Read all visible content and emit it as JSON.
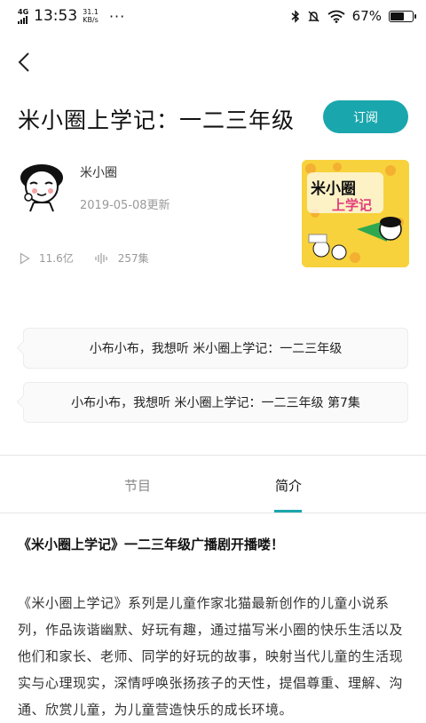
{
  "status_bar": {
    "network": "4G",
    "time": "13:53",
    "speed_value": "31.1",
    "speed_unit": "KB/s",
    "more": "···",
    "battery": "67%",
    "battery_level": 0.67
  },
  "header": {
    "back_icon": "chevron-left-icon"
  },
  "album": {
    "title": "米小圈上学记：一二三年级",
    "subscribe_label": "订阅",
    "author": "米小圈",
    "updated": "2019-05-08更新",
    "plays": "11.6亿",
    "episodes": "257集",
    "cover_text": "米小圈上学记",
    "accent_color": "#1aa6ad"
  },
  "voice_suggestions": [
    "小布小布，我想听 米小圈上学记：一二三年级",
    "小布小布，我想听 米小圈上学记：一二三年级 第7集"
  ],
  "tabs": [
    {
      "label": "节目",
      "active": false
    },
    {
      "label": "简介",
      "active": true
    }
  ],
  "intro": {
    "heading": "《米小圈上学记》一二三年级广播剧开播喽！",
    "body": "《米小圈上学记》系列是儿童作家北猫最新创作的儿童小说系列，作品诙谐幽默、好玩有趣，通过描写米小圈的快乐生活以及他们和家长、老师、同学的好玩的故事，映射当代儿童的生活现实与心理现实，深情呼唤张扬孩子的天性，提倡尊重、理解、沟通、欣赏儿童，为儿童营造快乐的成长环境。"
  }
}
